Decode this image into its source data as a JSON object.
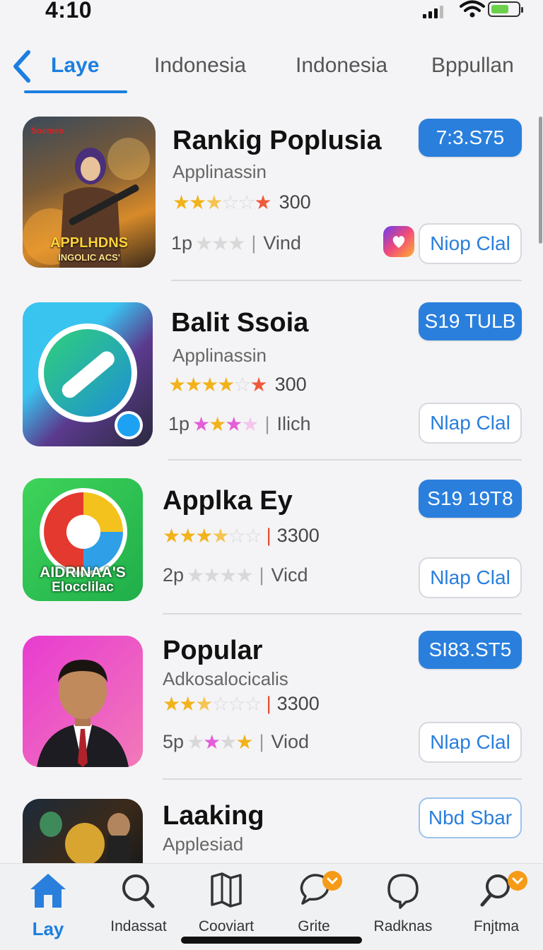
{
  "status": {
    "time": "4:10"
  },
  "tabs": {
    "back_icon": "chevron-left-icon",
    "items": [
      {
        "label": "Laye"
      },
      {
        "label": "Indonesia"
      },
      {
        "label": "Indonesia"
      },
      {
        "label": "Bppullan"
      }
    ]
  },
  "apps": [
    {
      "title": "Rankig Poplusia",
      "subtitle": "Applinassin",
      "rating_count": "300",
      "meta_prefix": "1p",
      "meta_text": "Vind",
      "price": "7:3.S75",
      "action": "Niop Clal",
      "icon_text_top": "APPLHDNS",
      "icon_text_bottom": "INGOLIC ACS'"
    },
    {
      "title": "Balit Ssoia",
      "subtitle": "Applinassin",
      "rating_count": "300",
      "meta_prefix": "1p",
      "meta_text": "Ilich",
      "price": "S19 TULB",
      "action": "Nlap Clal"
    },
    {
      "title": "Applka Ey",
      "subtitle": "",
      "rating_count": "3300",
      "meta_prefix": "2p",
      "meta_text": "Vicd",
      "price": "S19 19T8",
      "action": "Nlap Clal",
      "icon_text_top": "AIDRINAA'S",
      "icon_text_bottom": "Elocclilac"
    },
    {
      "title": "Popular",
      "subtitle": "Adkosalocicalis",
      "rating_count": "3300",
      "meta_prefix": "5p",
      "meta_text": "Viod",
      "price": "SI83.ST5",
      "action": "Nlap Clal"
    },
    {
      "title": "Laaking",
      "subtitle": "Applesiad",
      "action": "Nbd Sbar"
    }
  ],
  "bottom_nav": [
    {
      "label": "Lay",
      "icon": "home-icon"
    },
    {
      "label": "Indassat",
      "icon": "search-icon"
    },
    {
      "label": "Cooviart",
      "icon": "map-icon"
    },
    {
      "label": "Grite",
      "icon": "chat-icon"
    },
    {
      "label": "Radknas",
      "icon": "bubble-icon"
    },
    {
      "label": "Fnjtma",
      "icon": "search-icon"
    }
  ],
  "colors": {
    "accent": "#1c7fe0",
    "button": "#2a7fdc",
    "star": "#f2b21b"
  }
}
